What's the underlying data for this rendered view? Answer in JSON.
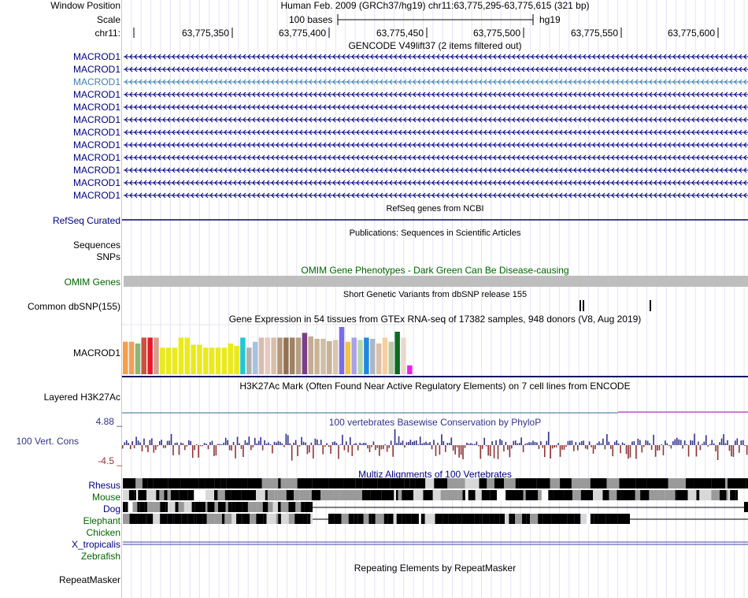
{
  "header": {
    "window_position_label": "Window Position",
    "window_position_value": "Human Feb. 2009 (GRCh37/hg19)   chr11:63,775,295-63,775,615 (321 bp)",
    "scale_label": "Scale",
    "scale_value": "100 bases",
    "scale_assembly": "hg19",
    "chrom_label": "chr11:",
    "ticks": [
      "63,775,350",
      "63,775,400",
      "63,775,450",
      "63,775,500",
      "63,775,550",
      "63,775,600"
    ]
  },
  "gencode": {
    "title": "GENCODE V49lift37 (2 items filtered out)",
    "items": [
      "MACROD1",
      "MACROD1",
      "MACROD1",
      "MACROD1",
      "MACROD1",
      "MACROD1",
      "MACROD1",
      "MACROD1",
      "MACROD1",
      "MACROD1",
      "MACROD1",
      "MACROD1"
    ],
    "highlight_index": 2
  },
  "refseq": {
    "title": "RefSeq genes from NCBI",
    "label": "RefSeq Curated"
  },
  "publications": {
    "title": "Publications: Sequences in Scientific Articles",
    "label1": "Sequences",
    "label2": "SNPs"
  },
  "omim": {
    "title": "OMIM Gene Phenotypes - Dark Green Can Be Disease-causing",
    "label": "OMIM Genes"
  },
  "dbsnp": {
    "title": "Short Genetic Variants from dbSNP release 155",
    "label": "Common dbSNP(155)"
  },
  "gtex": {
    "title": "Gene Expression in 54 tissues from GTEx RNA-seq of 17382 samples, 948 donors (V8, Aug 2019)",
    "label": "MACROD1",
    "bars": [
      {
        "v": 0.55,
        "c": "#f3a04a"
      },
      {
        "v": 0.55,
        "c": "#f0a05a"
      },
      {
        "v": 0.52,
        "c": "#8fb673"
      },
      {
        "v": 0.62,
        "c": "#c9523e"
      },
      {
        "v": 0.62,
        "c": "#e8182a"
      },
      {
        "v": 0.62,
        "c": "#d4a08d"
      },
      {
        "v": 0.45,
        "c": "#eaea1c"
      },
      {
        "v": 0.45,
        "c": "#eaea1c"
      },
      {
        "v": 0.45,
        "c": "#eaea1c"
      },
      {
        "v": 0.62,
        "c": "#eaea1c"
      },
      {
        "v": 0.62,
        "c": "#eaea1c"
      },
      {
        "v": 0.5,
        "c": "#eaea1c"
      },
      {
        "v": 0.5,
        "c": "#eaea1c"
      },
      {
        "v": 0.45,
        "c": "#eaea1c"
      },
      {
        "v": 0.45,
        "c": "#eaea1c"
      },
      {
        "v": 0.45,
        "c": "#eaea1c"
      },
      {
        "v": 0.45,
        "c": "#eaea1c"
      },
      {
        "v": 0.52,
        "c": "#eaea1c"
      },
      {
        "v": 0.48,
        "c": "#eaea1c"
      },
      {
        "v": 0.62,
        "c": "#23c7d0"
      },
      {
        "v": 0.45,
        "c": "#b0b0b0"
      },
      {
        "v": 0.55,
        "c": "#a6c2e0"
      },
      {
        "v": 0.62,
        "c": "#d9bcae"
      },
      {
        "v": 0.62,
        "c": "#e8c8c0"
      },
      {
        "v": 0.62,
        "c": "#d8bfa7"
      },
      {
        "v": 0.62,
        "c": "#b5987c"
      },
      {
        "v": 0.62,
        "c": "#927152"
      },
      {
        "v": 0.62,
        "c": "#9e8266"
      },
      {
        "v": 0.62,
        "c": "#b5a085"
      },
      {
        "v": 0.7,
        "c": "#7a3f87"
      },
      {
        "v": 0.64,
        "c": "#c3ad93"
      },
      {
        "v": 0.6,
        "c": "#c8b498"
      },
      {
        "v": 0.6,
        "c": "#cfbfa5"
      },
      {
        "v": 0.56,
        "c": "#c9b195"
      },
      {
        "v": 0.58,
        "c": "#d6c7b2"
      },
      {
        "v": 0.8,
        "c": "#7a6be8"
      },
      {
        "v": 0.55,
        "c": "#f5c242"
      },
      {
        "v": 0.62,
        "c": "#aaa1e6"
      },
      {
        "v": 0.58,
        "c": "#b3d6b0"
      },
      {
        "v": 0.62,
        "c": "#1f88df"
      },
      {
        "v": 0.6,
        "c": "#abb7c7"
      },
      {
        "v": 0.52,
        "c": "#d8c1a6"
      },
      {
        "v": 0.62,
        "c": "#f7cf9f"
      },
      {
        "v": 0.55,
        "c": "#b8c9a6"
      },
      {
        "v": 0.72,
        "c": "#0b6b1f"
      },
      {
        "v": 0.62,
        "c": "#ead8d0"
      },
      {
        "v": 0.15,
        "c": "#ee1fea"
      }
    ]
  },
  "h3k27ac": {
    "title": "H3K27Ac Mark (Often Found Near Active Regulatory Elements) on 7 cell lines from ENCODE",
    "label": "Layered H3K27Ac"
  },
  "cons": {
    "title": "100 vertebrates Basewise Conservation by PhyloP",
    "label": "100 Vert. Cons",
    "max_label": "4.88 _",
    "min_label": "-4.5 _"
  },
  "multiz": {
    "title": "Multiz Alignments of 100 Vertebrates",
    "species": [
      "Rhesus",
      "Mouse",
      "Dog",
      "Elephant",
      "Chicken",
      "X_tropicalis",
      "Zebrafish"
    ]
  },
  "repeatmasker": {
    "title": "Repeating Elements by RepeatMasker",
    "label": "RepeatMasker"
  },
  "colors": {
    "navy": "#000080",
    "green": "#006400",
    "highlight": "#4080b0",
    "cons_pos": "#33338a",
    "cons_neg": "#8f3535",
    "omim_bar": "#bebebe"
  }
}
